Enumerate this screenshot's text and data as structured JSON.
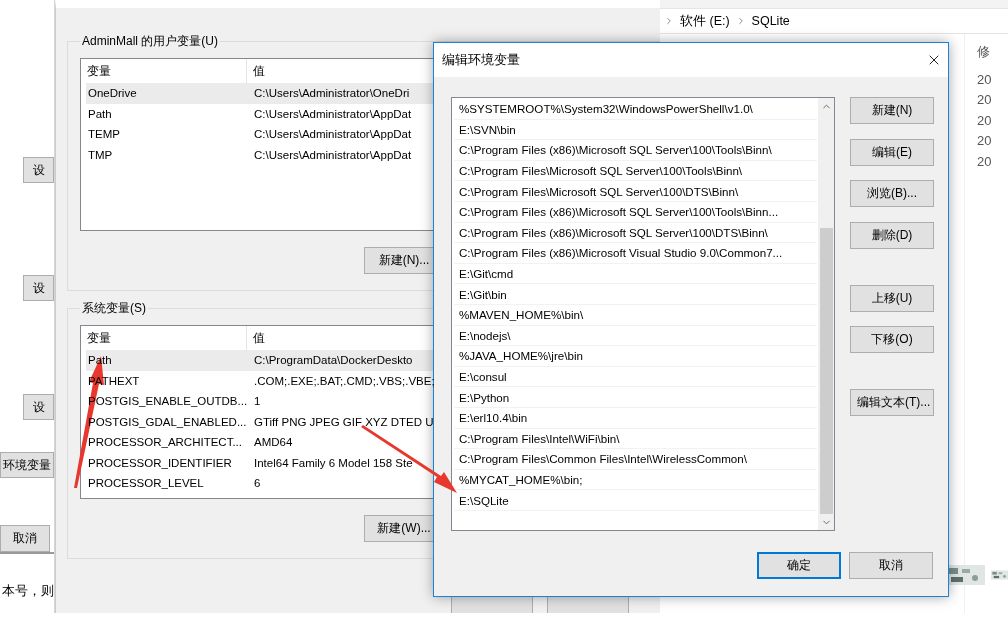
{
  "background_window": {
    "buttons": [
      "设",
      "设",
      "设",
      "环境变量",
      "取消"
    ],
    "footer_text": "本号，则"
  },
  "env_window": {
    "user_group": {
      "title": "AdminMall 的用户变量(U)",
      "columns": [
        "变量",
        "值"
      ],
      "rows": [
        {
          "name": "OneDrive",
          "value": "C:\\Users\\Administrator\\OneDri",
          "selected": true
        },
        {
          "name": "Path",
          "value": "C:\\Users\\Administrator\\AppDat",
          "selected": false
        },
        {
          "name": "TEMP",
          "value": "C:\\Users\\Administrator\\AppDat",
          "selected": false
        },
        {
          "name": "TMP",
          "value": "C:\\Users\\Administrator\\AppDat",
          "selected": false
        }
      ],
      "new_button": "新建(N)..."
    },
    "system_group": {
      "title": "系统变量(S)",
      "columns": [
        "变量",
        "值"
      ],
      "rows": [
        {
          "name": "Path",
          "value": "C:\\ProgramData\\DockerDeskto",
          "selected": true
        },
        {
          "name": "PATHEXT",
          "value": ".COM;.EXE;.BAT;.CMD;.VBS;.VBE;",
          "selected": false
        },
        {
          "name": "POSTGIS_ENABLE_OUTDB...",
          "value": "1",
          "selected": false
        },
        {
          "name": "POSTGIS_GDAL_ENABLED...",
          "value": "GTiff PNG JPEG GIF XYZ DTED U",
          "selected": false
        },
        {
          "name": "PROCESSOR_ARCHITECT...",
          "value": "AMD64",
          "selected": false
        },
        {
          "name": "PROCESSOR_IDENTIFIER",
          "value": "Intel64 Family 6 Model 158 Ste",
          "selected": false
        },
        {
          "name": "PROCESSOR_LEVEL",
          "value": "6",
          "selected": false
        }
      ],
      "new_button": "新建(W)..."
    }
  },
  "explorer": {
    "breadcrumb": [
      "软件 (E:)",
      "SQLite"
    ],
    "column_header": "修",
    "dates": [
      "20",
      "20",
      "20",
      "20",
      "20"
    ]
  },
  "dialog": {
    "title": "编辑环境变量",
    "paths": [
      "%SYSTEMROOT%\\System32\\WindowsPowerShell\\v1.0\\",
      "E:\\SVN\\bin",
      "C:\\Program Files (x86)\\Microsoft SQL Server\\100\\Tools\\Binn\\",
      "C:\\Program Files\\Microsoft SQL Server\\100\\Tools\\Binn\\",
      "C:\\Program Files\\Microsoft SQL Server\\100\\DTS\\Binn\\",
      "C:\\Program Files (x86)\\Microsoft SQL Server\\100\\Tools\\Binn...",
      "C:\\Program Files (x86)\\Microsoft SQL Server\\100\\DTS\\Binn\\",
      "C:\\Program Files (x86)\\Microsoft Visual Studio 9.0\\Common7...",
      "E:\\Git\\cmd",
      "E:\\Git\\bin",
      "%MAVEN_HOME%\\bin\\",
      "E:\\nodejs\\",
      "%JAVA_HOME%\\jre\\bin",
      "E:\\consul",
      "E:\\Python",
      "E:\\erl10.4\\bin",
      "C:\\Program Files\\Intel\\WiFi\\bin\\",
      "C:\\Program Files\\Common Files\\Intel\\WirelessCommon\\",
      "%MYCAT_HOME%\\bin;",
      "E:\\SQLite"
    ],
    "side_button_groups": [
      [
        "新建(N)",
        "编辑(E)",
        "浏览(B)...",
        "删除(D)"
      ],
      [
        "上移(U)",
        "下移(O)"
      ],
      [
        "编辑文本(T)..."
      ]
    ],
    "footer_buttons": [
      {
        "label": "确定",
        "default": true
      },
      {
        "label": "取消",
        "default": false
      }
    ]
  }
}
